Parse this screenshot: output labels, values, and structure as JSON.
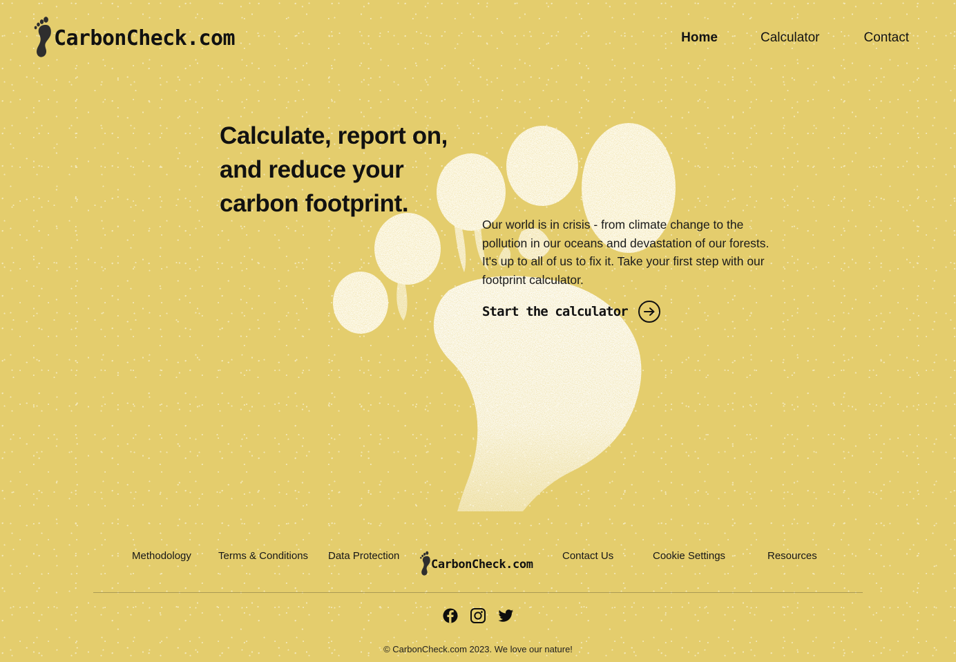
{
  "site": {
    "brand_name": "CarbonCheck.com",
    "background_color": "#e4cd6d",
    "text_color": "#111111",
    "footprint_color": "#fffdf5"
  },
  "header": {
    "logo_icon": "footprint-icon",
    "brand": "CarbonCheck.com",
    "nav": [
      {
        "label": "Home",
        "active": true
      },
      {
        "label": "Calculator",
        "active": false
      },
      {
        "label": "Contact",
        "active": false
      }
    ]
  },
  "hero": {
    "headline_lines": [
      "Calculate, report on,",
      "and reduce your",
      "carbon footprint."
    ],
    "body": "Our world is in crisis - from climate change to the pollution in our oceans and devastation of our forests. It's up to all of us to fix it. Take your first step with our footprint calculator.",
    "cta_label": "Start the calculator",
    "cta_icon": "arrow-right-circle-icon",
    "background_graphic": "footprint-illustration"
  },
  "footer": {
    "links_left": [
      {
        "label": "Methodology"
      },
      {
        "label": "Terms & Conditions"
      },
      {
        "label": "Data Protection"
      }
    ],
    "brand": "CarbonCheck.com",
    "logo_icon": "footprint-icon",
    "links_right": [
      {
        "label": "Contact Us"
      },
      {
        "label": "Cookie Settings"
      },
      {
        "label": "Resources"
      }
    ],
    "social": [
      {
        "name": "facebook-icon",
        "label": "Facebook"
      },
      {
        "name": "instagram-icon",
        "label": "Instagram"
      },
      {
        "name": "twitter-icon",
        "label": "Twitter"
      }
    ],
    "copyright": "© CarbonCheck.com 2023. We love our nature!"
  }
}
